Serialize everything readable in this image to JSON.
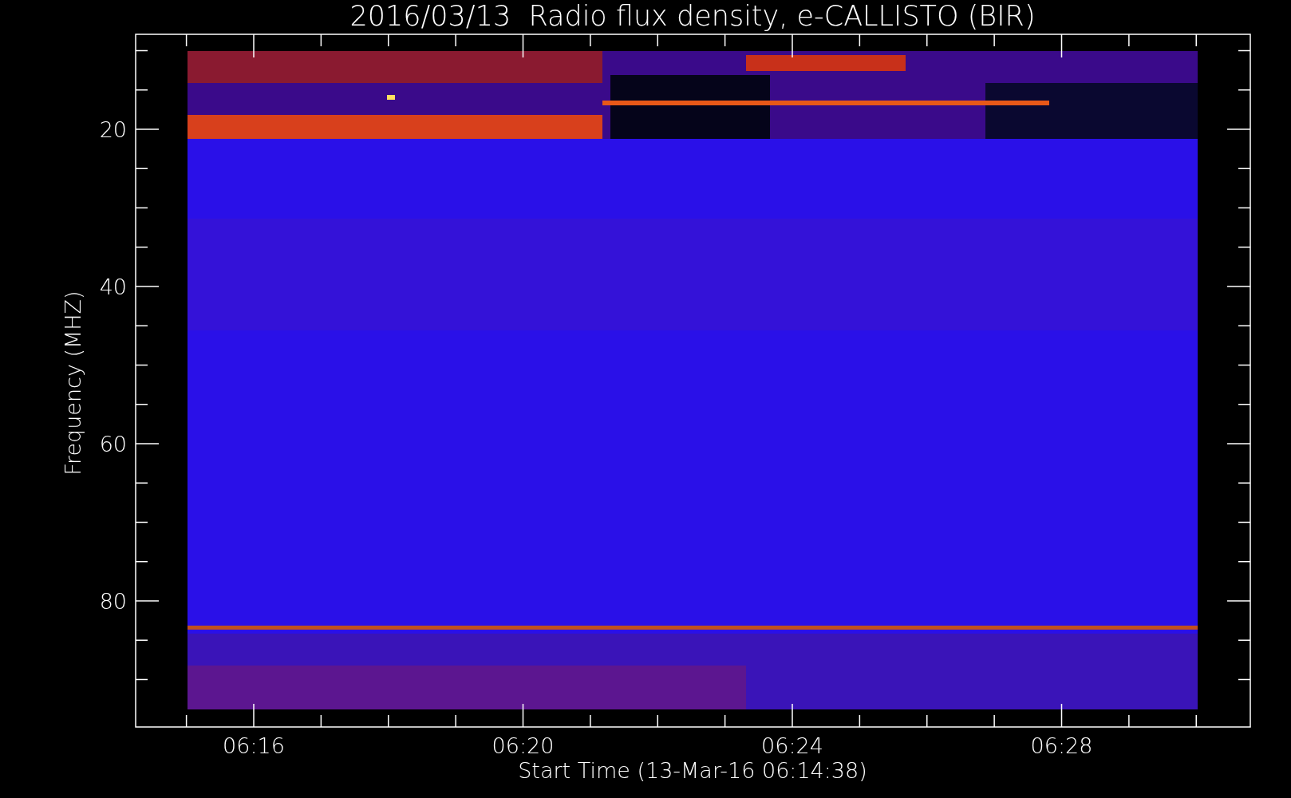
{
  "title": "2016/03/13  Radio flux density, e-CALLISTO (BIR)",
  "y_axis": {
    "label": "Frequency (MHZ)",
    "ticks": [
      "20",
      "40",
      "60",
      "80"
    ]
  },
  "x_axis": {
    "label": "Start Time (13-Mar-16 06:14:38)",
    "ticks": [
      "06:16",
      "06:20",
      "06:24",
      "06:28"
    ]
  }
}
